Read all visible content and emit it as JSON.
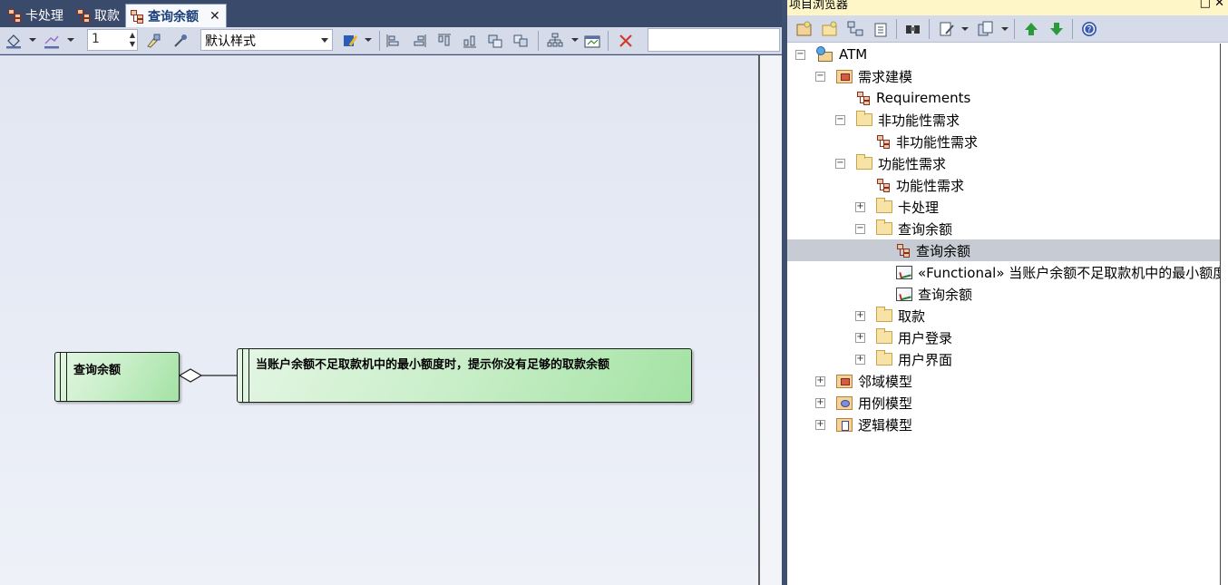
{
  "tabs": [
    {
      "label": "卡处理",
      "active": false
    },
    {
      "label": "取款",
      "active": false
    },
    {
      "label": "查询余额",
      "active": true
    }
  ],
  "toolbar": {
    "line_width_value": "1",
    "style_value": "默认样式",
    "search_value": ""
  },
  "diagram": {
    "element1_name": "查询余额",
    "element2_text": "当账户余额不足取款机中的最小额度时，提示你没有足够的取款余额"
  },
  "browser": {
    "title": "项目浏览器",
    "tree": [
      {
        "label": "ATM",
        "icon": "model-icon",
        "expander": "minus"
      },
      {
        "label": "需求建模",
        "icon": "requirements-package-icon",
        "expander": "minus"
      },
      {
        "label": "Requirements",
        "icon": "diagram-icon",
        "expander": "none"
      },
      {
        "label": "非功能性需求",
        "icon": "folder-icon",
        "expander": "minus"
      },
      {
        "label": "非功能性需求",
        "icon": "diagram-icon",
        "expander": "none"
      },
      {
        "label": "功能性需求",
        "icon": "folder-icon",
        "expander": "minus"
      },
      {
        "label": "功能性需求",
        "icon": "diagram-icon",
        "expander": "none"
      },
      {
        "label": "卡处理",
        "icon": "folder-icon",
        "expander": "plus"
      },
      {
        "label": "查询余额",
        "icon": "folder-icon",
        "expander": "minus"
      },
      {
        "label": "查询余额",
        "icon": "diagram-icon",
        "expander": "none",
        "selected": true
      },
      {
        "label": "«Functional» 当账户余额不足取款机中的最小额度",
        "icon": "requirement-icon",
        "expander": "none"
      },
      {
        "label": "查询余额",
        "icon": "requirement-icon",
        "expander": "none"
      },
      {
        "label": "取款",
        "icon": "folder-icon",
        "expander": "plus"
      },
      {
        "label": "用户登录",
        "icon": "folder-icon",
        "expander": "plus"
      },
      {
        "label": "用户界面",
        "icon": "folder-icon",
        "expander": "plus"
      },
      {
        "label": "邻域模型",
        "icon": "domain-package-icon",
        "expander": "plus"
      },
      {
        "label": "用例模型",
        "icon": "usecase-package-icon",
        "expander": "plus"
      },
      {
        "label": "逻辑模型",
        "icon": "logical-package-icon",
        "expander": "plus"
      }
    ]
  }
}
